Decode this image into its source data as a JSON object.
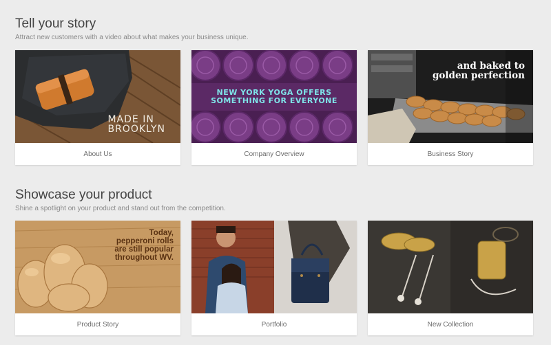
{
  "sections": [
    {
      "title": "Tell your story",
      "subtitle": "Attract new customers with a video about what makes your business unique.",
      "cards": [
        {
          "caption": "About Us",
          "overlay": "MADE IN\nBROOKLYN"
        },
        {
          "caption": "Company Overview",
          "overlay": "NEW YORK YOGA OFFERS\nSOMETHING FOR EVERYONE"
        },
        {
          "caption": "Business Story",
          "overlay": "and baked to\ngolden perfection"
        }
      ]
    },
    {
      "title": "Showcase your product",
      "subtitle": "Shine a spotlight on your product and stand out from the competition.",
      "cards": [
        {
          "caption": "Product Story",
          "overlay": "Today,\npepperoni rolls\nare still popular\nthroughout WV."
        },
        {
          "caption": "Portfolio"
        },
        {
          "caption": "New Collection"
        }
      ]
    }
  ]
}
